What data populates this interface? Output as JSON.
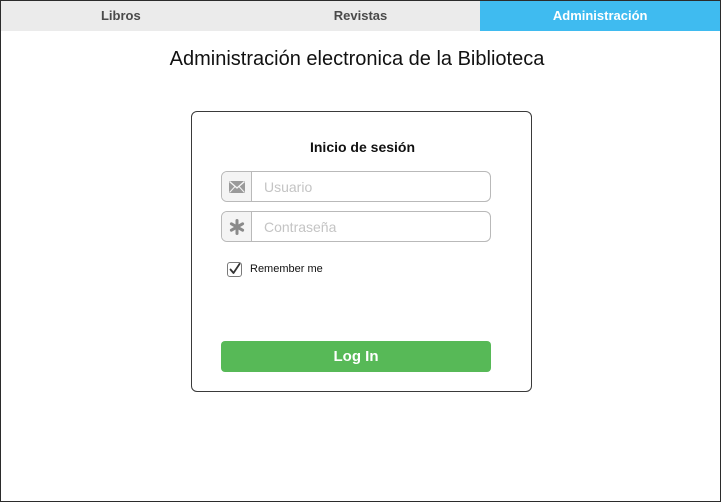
{
  "tabs": [
    {
      "label": "Libros",
      "active": false
    },
    {
      "label": "Revistas",
      "active": false
    },
    {
      "label": "Administración",
      "active": true
    }
  ],
  "page_title": "Administración electronica de la Biblioteca",
  "login": {
    "title": "Inicio de sesión",
    "username": {
      "placeholder": "Usuario",
      "value": "",
      "icon": "envelope-icon"
    },
    "password": {
      "placeholder": "Contraseña",
      "value": "",
      "icon": "asterisk-icon"
    },
    "remember_me": {
      "label": "Remember me",
      "checked": true
    },
    "submit_label": "Log In"
  },
  "colors": {
    "active_tab": "#3fbbf0",
    "inactive_tab": "#ebebeb",
    "login_button": "#57b957"
  }
}
